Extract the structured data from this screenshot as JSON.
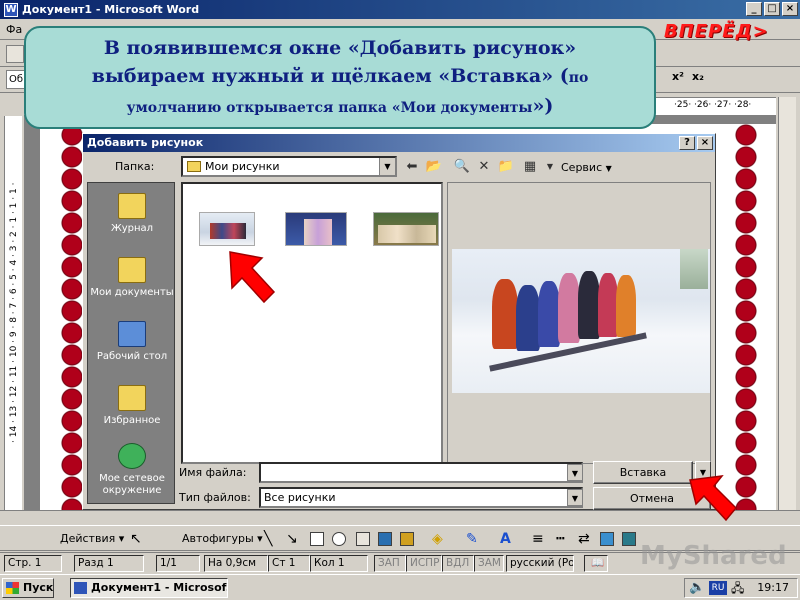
{
  "word": {
    "title": "Документ1 - Microsoft Word",
    "menu_first": "Фа",
    "style_box": "Об",
    "ruler_ticks": "·25· ·26· ·27· ·28·",
    "vruler_ticks": "· 14 · 13 · 12 · 11 · 10 · 9 · 8 · 7 · 6 · 5 · 4 · 3 · 2 · 1 · 1 · 1 ·",
    "superscript": "x²",
    "subscript": "x₂"
  },
  "forward_label": "ВПЕРЁД>",
  "callout": {
    "line1": "В появившемся окне «Добавить рисунок»",
    "line2": "выбираем нужный и щёлкаем «Вставка» (",
    "line2_small": "по",
    "line3_small": "умолчанию открывается папка «",
    "line3_normal": "Мои документы",
    "line3_end": "»)"
  },
  "dialog": {
    "title": "Добавить рисунок",
    "folder_label": "Папка:",
    "folder_value": "Мои рисунки",
    "service_label": "Сервис",
    "places": [
      "Журнал",
      "Мои документы",
      "Рабочий стол",
      "Избранное",
      "Мое сетевое окружение"
    ],
    "file_name_label": "Имя файла:",
    "file_name_value": "",
    "file_type_label": "Тип файлов:",
    "file_type_value": "Все рисунки",
    "insert_label": "Вставка",
    "cancel_label": "Отмена"
  },
  "drawbar": {
    "actions": "Действия",
    "autoshapes": "Автофигуры"
  },
  "status": {
    "page": "Стр. 1",
    "section": "Разд 1",
    "pages": "1/1",
    "at": "На 0,9см",
    "line": "Ст 1",
    "col": "Кол 1",
    "rec": "ЗАП",
    "trk": "ИСПР",
    "ext": "ВДЛ",
    "ovr": "ЗАМ",
    "language": "русский (Ро"
  },
  "taskbar": {
    "start": "Пуск",
    "task": "Документ1 - Microsof...",
    "lang": "RU",
    "clock": "19:17"
  },
  "watermark": "MyShared"
}
